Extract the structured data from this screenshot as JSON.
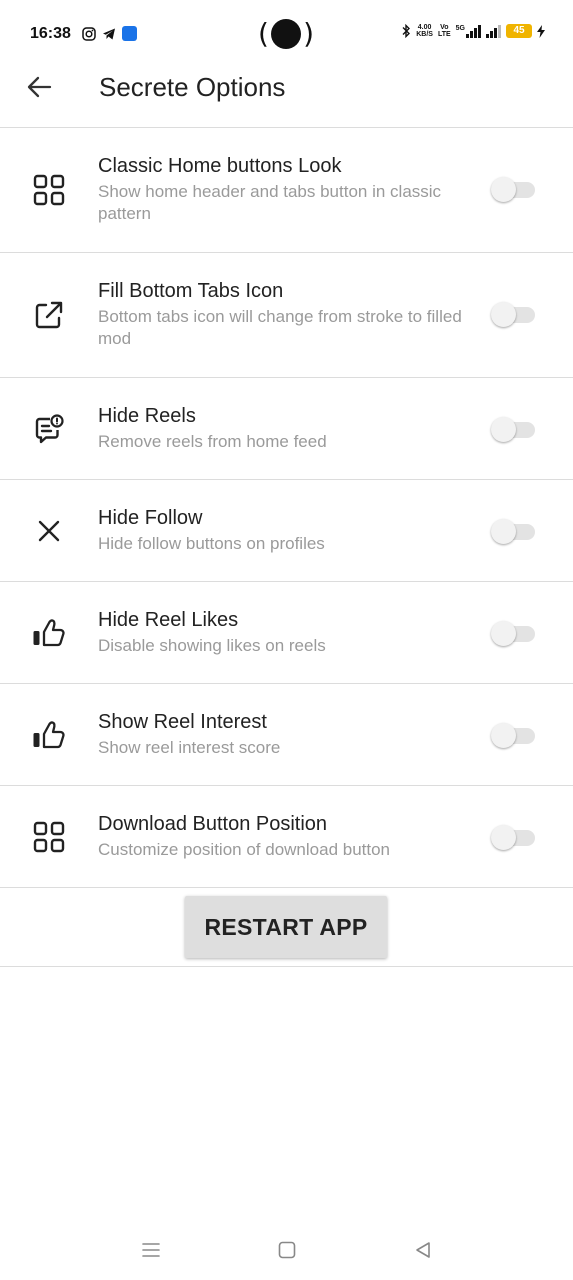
{
  "status_bar": {
    "time": "16:38",
    "left_icons": [
      "instagram-icon",
      "telegram-icon",
      "app-icon"
    ],
    "speed_value": "4.00",
    "speed_unit": "KB/S",
    "volte_top": "Vo",
    "volte_bottom": "LTE",
    "network": "5G",
    "battery": "45",
    "accent_battery": "#f0b400"
  },
  "app_bar": {
    "title": "Secrete Options",
    "back_icon": "arrow-left-icon"
  },
  "settings": [
    {
      "title": "Classic Home buttons Look",
      "subtitle": "Show home header and tabs button in classic pattern",
      "icon": "grid-icon",
      "enabled": false
    },
    {
      "title": "Fill Bottom Tabs Icon",
      "subtitle": "Bottom tabs icon will change from stroke to filled mod",
      "icon": "external-link-icon",
      "enabled": false
    },
    {
      "title": "Hide Reels",
      "subtitle": "Remove reels from home feed",
      "icon": "message-badge-icon",
      "enabled": false
    },
    {
      "title": "Hide Follow",
      "subtitle": "Hide follow buttons on profiles",
      "icon": "close-icon",
      "enabled": false
    },
    {
      "title": "Hide Reel Likes",
      "subtitle": "Disable showing likes on reels",
      "icon": "thumbs-up-icon",
      "enabled": false
    },
    {
      "title": "Show Reel Interest",
      "subtitle": "Show reel interest score",
      "icon": "thumbs-up-icon",
      "enabled": false
    },
    {
      "title": "Download Button Position",
      "subtitle": "Customize position of download button",
      "icon": "grid-icon",
      "enabled": false
    }
  ],
  "restart_button": {
    "label": "RESTART APP"
  },
  "nav_bar": {
    "icons": [
      "menu-icon",
      "home-square-icon",
      "back-triangle-icon"
    ]
  }
}
